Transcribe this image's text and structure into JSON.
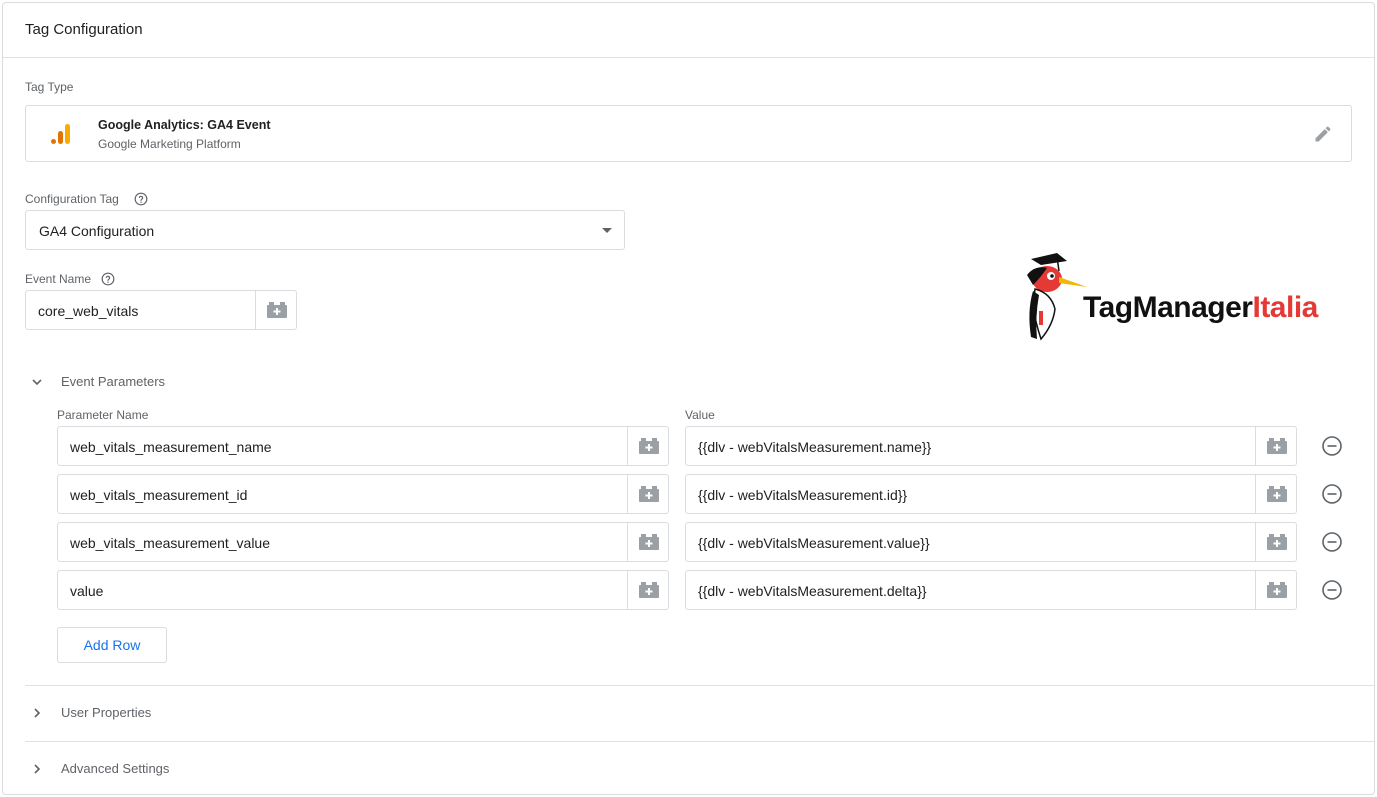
{
  "header": {
    "title": "Tag Configuration"
  },
  "tag_type": {
    "label": "Tag Type",
    "name": "Google Analytics: GA4 Event",
    "platform": "Google Marketing Platform",
    "icon": "google-analytics-icon",
    "accent": "#f9ab00"
  },
  "config_tag": {
    "label": "Configuration Tag",
    "value": "GA4 Configuration"
  },
  "event_name": {
    "label": "Event Name",
    "value": "core_web_vitals"
  },
  "event_params": {
    "label": "Event Parameters",
    "col_name": "Parameter Name",
    "col_value": "Value",
    "rows": [
      {
        "name": "web_vitals_measurement_name",
        "value": "{{dlv - webVitalsMeasurement.name}}"
      },
      {
        "name": "web_vitals_measurement_id",
        "value": "{{dlv - webVitalsMeasurement.id}}"
      },
      {
        "name": "web_vitals_measurement_value",
        "value": "{{dlv - webVitalsMeasurement.value}}"
      },
      {
        "name": "value",
        "value": "{{dlv - webVitalsMeasurement.delta}}"
      }
    ],
    "add_row": "Add Row"
  },
  "user_properties": {
    "label": "User Properties"
  },
  "advanced_settings": {
    "label": "Advanced Settings"
  },
  "brand": {
    "part1": "TagManager",
    "part2": "Italia",
    "color_accent": "#e53935"
  },
  "colors": {
    "link": "#1a73e8",
    "border": "#dadce0",
    "muted": "#5f6368"
  }
}
